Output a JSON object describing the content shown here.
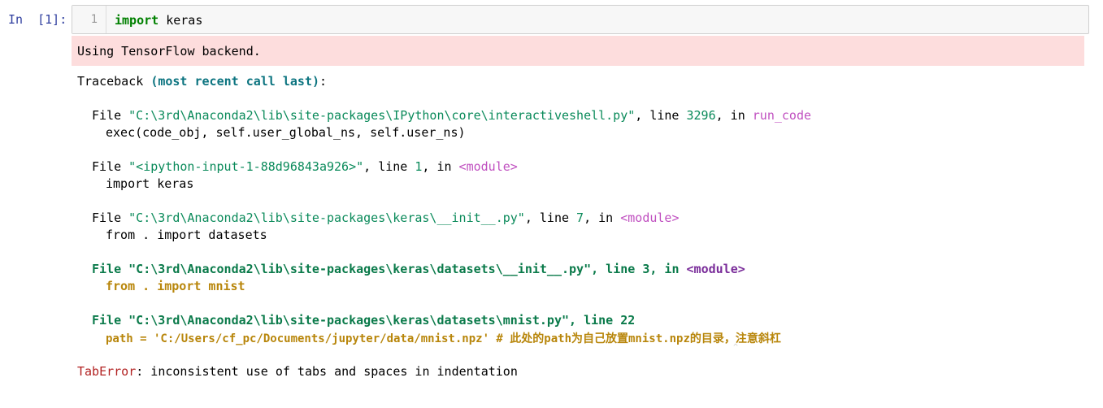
{
  "cell": {
    "prompt": "In  [1]:",
    "line_number": "1",
    "code": {
      "keyword": "import",
      "rest": " keras"
    }
  },
  "stderr": {
    "text": "Using TensorFlow backend."
  },
  "traceback": {
    "header_word": "Traceback ",
    "header_paren": "(most recent call last)",
    "header_colon": ":",
    "frames": [
      {
        "file_kw": "File ",
        "path": "\"C:\\3rd\\Anaconda2\\lib\\site-packages\\IPython\\core\\interactiveshell.py\"",
        "line_kw": ", line ",
        "line_no": "3296",
        "in_kw": ", in ",
        "func": "run_code",
        "code": "exec(code_obj, self.user_global_ns, self.user_ns)"
      },
      {
        "file_kw": "File ",
        "path": "\"<ipython-input-1-88d96843a926>\"",
        "line_kw": ", line ",
        "line_no": "1",
        "in_kw": ", in ",
        "func": "<module>",
        "code": "import keras"
      },
      {
        "file_kw": "File ",
        "path": "\"C:\\3rd\\Anaconda2\\lib\\site-packages\\keras\\__init__.py\"",
        "line_kw": ", line ",
        "line_no": "7",
        "in_kw": ", in ",
        "func": "<module>",
        "code": "from . import datasets"
      },
      {
        "file_kw": "File ",
        "path": "\"C:\\3rd\\Anaconda2\\lib\\site-packages\\keras\\datasets\\__init__.py\"",
        "line_kw": ", line ",
        "line_no": "3",
        "in_kw": ", in ",
        "func": "<module>",
        "code": "from . import mnist"
      },
      {
        "file_kw": "File ",
        "path": "\"C:\\3rd\\Anaconda2\\lib\\site-packages\\keras\\datasets\\mnist.py\"",
        "line_kw": ", line ",
        "line_no": "22",
        "code": "path = 'C:/Users/cf_pc/Documents/jupyter/data/mnist.npz' # 此处的path为自己放置mnist.npz的目录，注意斜杠",
        "caret": "^"
      }
    ],
    "error_name": "TabError",
    "error_message": ": inconsistent use of tabs and spaces in indentation"
  },
  "colors": {
    "stderr_bg": "#fddddd",
    "prompt": "#303f9f",
    "keyword": "#008000",
    "error": "#b22222"
  }
}
